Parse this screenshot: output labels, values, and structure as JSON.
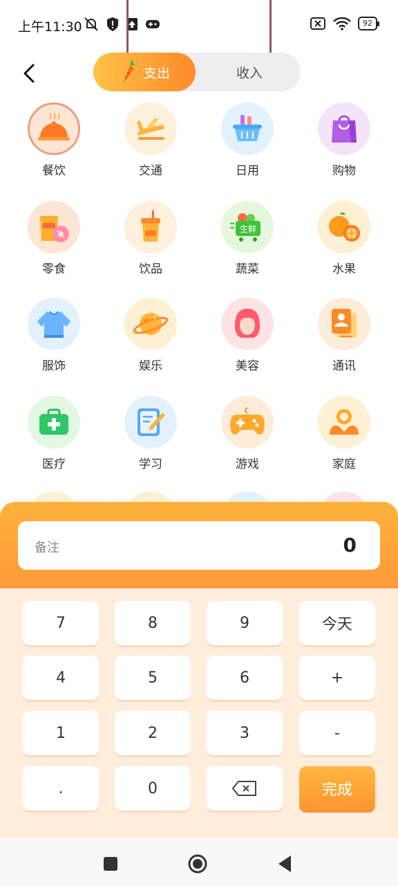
{
  "status_bar": {
    "time": "上午11:30",
    "battery": "92"
  },
  "header": {
    "tab_expense": "支出",
    "tab_income": "收入"
  },
  "categories": [
    {
      "label": "餐饮",
      "icon": "dining-cloche-icon",
      "bg": "#fde6d3"
    },
    {
      "label": "交通",
      "icon": "airplane-icon",
      "bg": "#fdf0dc"
    },
    {
      "label": "日用",
      "icon": "basket-icon",
      "bg": "#e3f1fc"
    },
    {
      "label": "购物",
      "icon": "shopping-bag-icon",
      "bg": "#f3e4fa"
    },
    {
      "label": "零食",
      "icon": "snack-donut-icon",
      "bg": "#fde6d3"
    },
    {
      "label": "饮品",
      "icon": "drink-cup-icon",
      "bg": "#fdf0dc"
    },
    {
      "label": "蔬菜",
      "icon": "vegetable-cart-icon",
      "bg": "#e5f8dc"
    },
    {
      "label": "水果",
      "icon": "orange-fruit-icon",
      "bg": "#fdf0d3"
    },
    {
      "label": "服饰",
      "icon": "sweater-icon",
      "bg": "#e3f1fc"
    },
    {
      "label": "娱乐",
      "icon": "planet-icon",
      "bg": "#fdf0d3"
    },
    {
      "label": "美容",
      "icon": "woman-face-icon",
      "bg": "#fde3e3"
    },
    {
      "label": "通讯",
      "icon": "contact-card-icon",
      "bg": "#fdecd8"
    },
    {
      "label": "医疗",
      "icon": "medical-kit-icon",
      "bg": "#e3f8e3"
    },
    {
      "label": "学习",
      "icon": "notepad-pen-icon",
      "bg": "#e3f1fc"
    },
    {
      "label": "游戏",
      "icon": "gamepad-icon",
      "bg": "#fdecd8"
    },
    {
      "label": "家庭",
      "icon": "family-icon",
      "bg": "#fdf0d3"
    }
  ],
  "note_input": {
    "placeholder": "备注",
    "amount": "0"
  },
  "keypad": [
    [
      "7",
      "8",
      "9",
      "今天"
    ],
    [
      "4",
      "5",
      "6",
      "+"
    ],
    [
      "1",
      "2",
      "3",
      "-"
    ],
    [
      ".",
      "0",
      "backspace-icon",
      "完成"
    ]
  ],
  "colors": {
    "accent_start": "#ffc247",
    "accent_end": "#ff8a2b",
    "panel_bg": "#ffeddb"
  }
}
